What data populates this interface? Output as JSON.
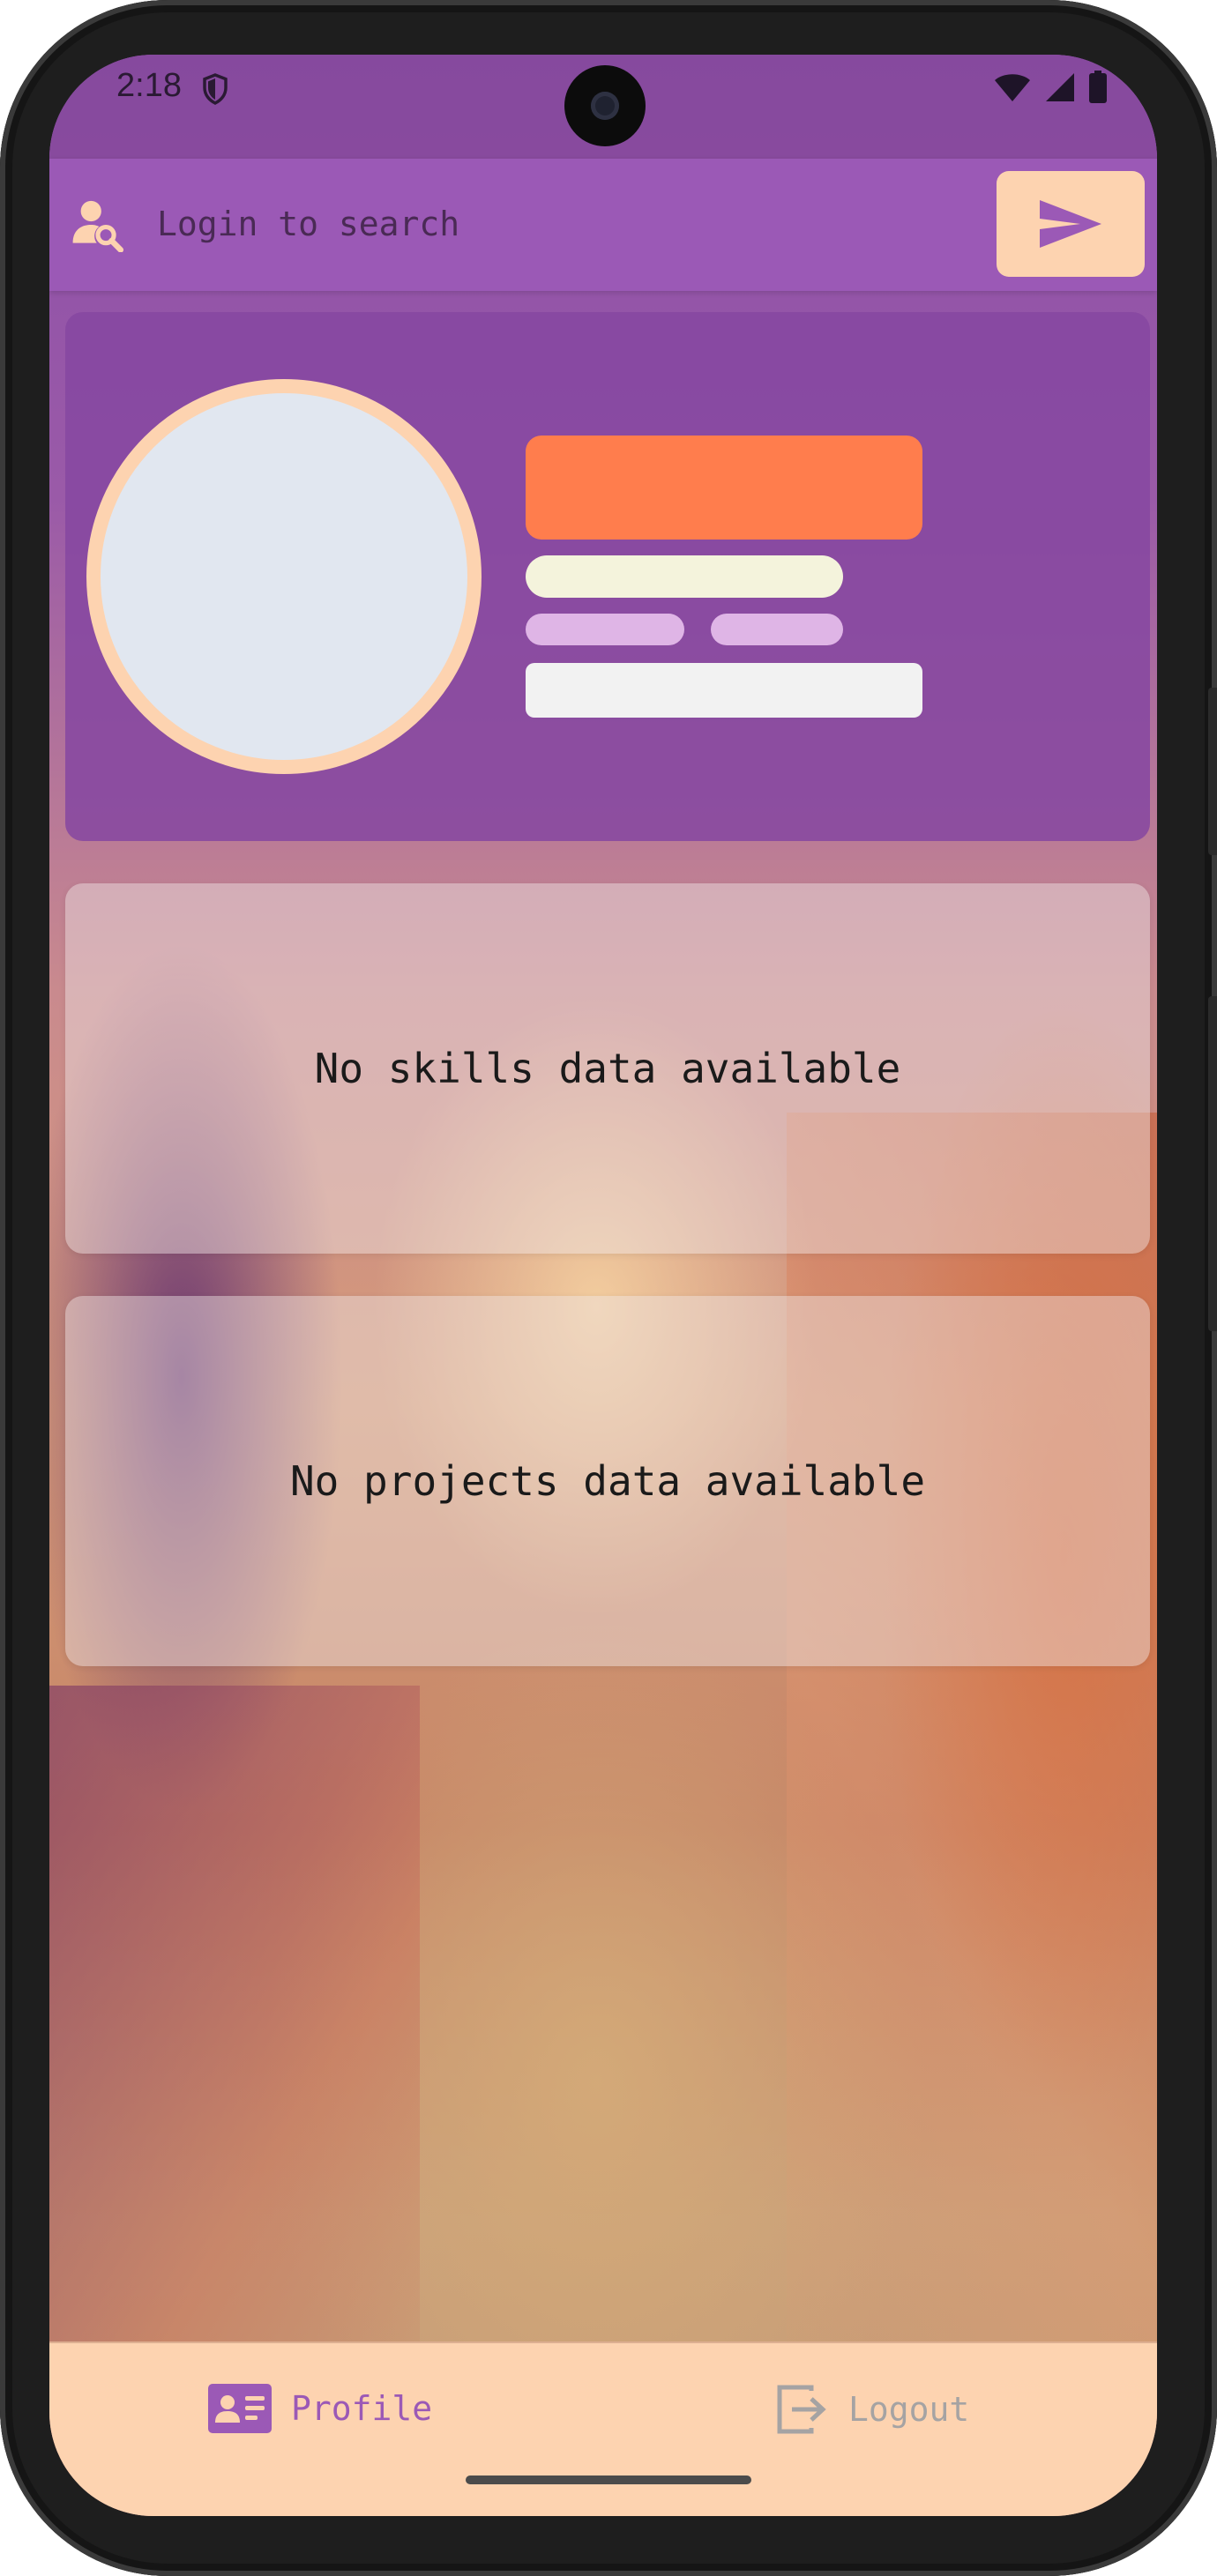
{
  "status_bar": {
    "time": "2:18"
  },
  "search": {
    "placeholder": "Login to search"
  },
  "skills": {
    "empty_message": "No skills data available"
  },
  "projects": {
    "empty_message": "No projects data available"
  },
  "nav": {
    "items": [
      {
        "label": "Profile",
        "icon": "profile-card-icon",
        "active": true
      },
      {
        "label": "Logout",
        "icon": "logout-icon",
        "active": false
      }
    ]
  },
  "colors": {
    "primary": "#9b59b6",
    "accent": "#ff7d4d",
    "surface": "#fdd3b0",
    "inactive": "#a5a3a3"
  }
}
